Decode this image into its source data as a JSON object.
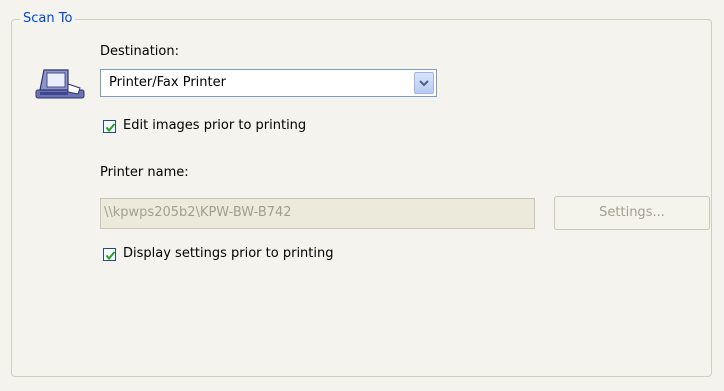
{
  "group": {
    "title": "Scan To"
  },
  "destination": {
    "label": "Destination:",
    "selected": "Printer/Fax Printer",
    "icon": "printer-icon"
  },
  "edit_images": {
    "label": "Edit images prior to printing",
    "checked": true
  },
  "printer_name": {
    "label": "Printer name:",
    "value": "\\\\kpwps205b2\\KPW-BW-B742"
  },
  "settings_button": {
    "label": "Settings...",
    "enabled": false
  },
  "display_settings": {
    "label": "Display settings prior to printing",
    "checked": true
  },
  "colors": {
    "accent": "#0046d5",
    "background": "#f4f3ee",
    "check": "#21a121"
  }
}
